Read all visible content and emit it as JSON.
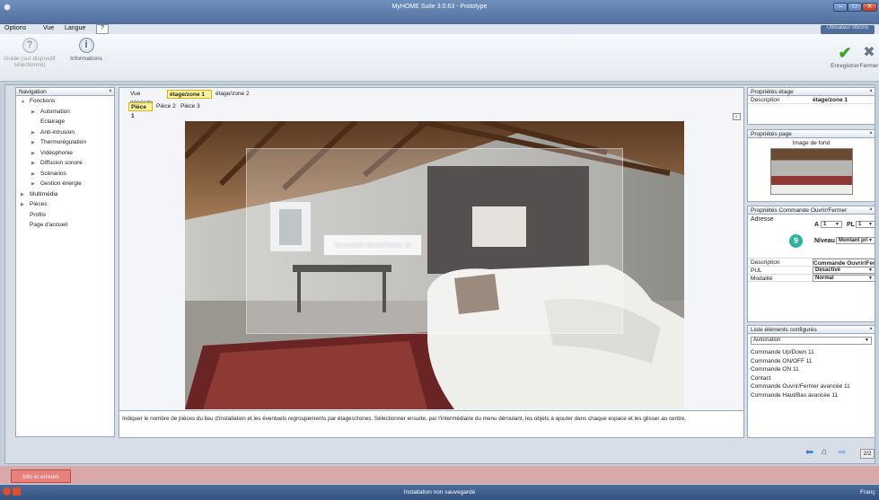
{
  "window": {
    "title": "MyHOME Suite 3.0.63 - Prototype"
  },
  "menu": {
    "items": [
      "Options",
      "Vue",
      "Langue",
      "?"
    ],
    "user_badge": "Utilisateur Bticino"
  },
  "toolbar": {
    "guide_label": "Guide (sur dispositif sélectionné)",
    "info_label": "Informations",
    "save_label": "Enregistrer",
    "close_label": "Fermer"
  },
  "navigation": {
    "title": "Navigation",
    "items": [
      {
        "label": "Fonctions",
        "level": 0,
        "arrow": "▲"
      },
      {
        "label": "Automation",
        "level": 1,
        "arrow": "▶"
      },
      {
        "label": "Eclairage",
        "level": 1,
        "arrow": ""
      },
      {
        "label": "Anti-intrusion",
        "level": 1,
        "arrow": "▶"
      },
      {
        "label": "Thermorégulation",
        "level": 1,
        "arrow": "▶"
      },
      {
        "label": "Vidéophonie",
        "level": 1,
        "arrow": "▶"
      },
      {
        "label": "Diffusion sonore",
        "level": 1,
        "arrow": "▶"
      },
      {
        "label": "Scénarios",
        "level": 1,
        "arrow": "▶"
      },
      {
        "label": "Gestion énergie",
        "level": 1,
        "arrow": "▶"
      },
      {
        "label": "Multimédia",
        "level": 0,
        "arrow": "▶"
      },
      {
        "label": "Pièces",
        "level": 0,
        "arrow": "▶"
      },
      {
        "label": "Profils",
        "level": 0,
        "arrow": ""
      },
      {
        "label": "Page d'accueil",
        "level": 0,
        "arrow": ""
      }
    ]
  },
  "tabs": {
    "floors": [
      "Vue générale",
      "étage/zone 1",
      "étage/zone 2"
    ],
    "rooms": [
      "Pièce 1",
      "Pièce 2",
      "Pièce 3"
    ]
  },
  "canvas": {
    "overlay_label": "Commande Ouvrir/Fermer 11"
  },
  "hint": "Indiquer le nombre de pièces du lieu d'installation et les éventuels regroupements par étages/zones. Sélectionner ensuite, par l'intermédiaire du menu déroulant, les objets à ajouter dans chaque espace et les glisser au centre.",
  "floor_props": {
    "title": "Propriétés étage",
    "description_label": "Description",
    "description_value": "étage/zone 1"
  },
  "page_props": {
    "title": "Propriétés page",
    "background_label": "Image de fond"
  },
  "command_props": {
    "title": "Propriétés Commande Ouvrir/Fermer",
    "address_label": "Adresse",
    "a_label": "A",
    "a_value": "1",
    "pl_label": "PL",
    "pl_value": "1",
    "level_label": "Niveau",
    "level_value": "Montant pri",
    "badge": "9",
    "description_label": "Description",
    "description_value": "Commande Ouvrir/Ferm",
    "pul_label": "PUL",
    "pul_value": "Desactivé",
    "mode_label": "Modalité",
    "mode_value": "Normal"
  },
  "configured": {
    "title": "Liste éléments configurés",
    "filter": "Automation",
    "items": [
      "Commande Up/Down 11",
      "Commande ON/OFF 11",
      "Commande ON 11",
      "Contact",
      "Commande Ouvrir/Fermer avancée 11",
      "Commande Haut/Bas avancée 11"
    ]
  },
  "pager": "2/2",
  "info_tab": "Info et erreurs",
  "status": {
    "center": "Installation non sauvegardé",
    "right": "Franç"
  },
  "colors": {
    "accent_tab": "#fff4a6",
    "badge": "#2bb3a0",
    "title_bar": "#5a7aa9"
  }
}
